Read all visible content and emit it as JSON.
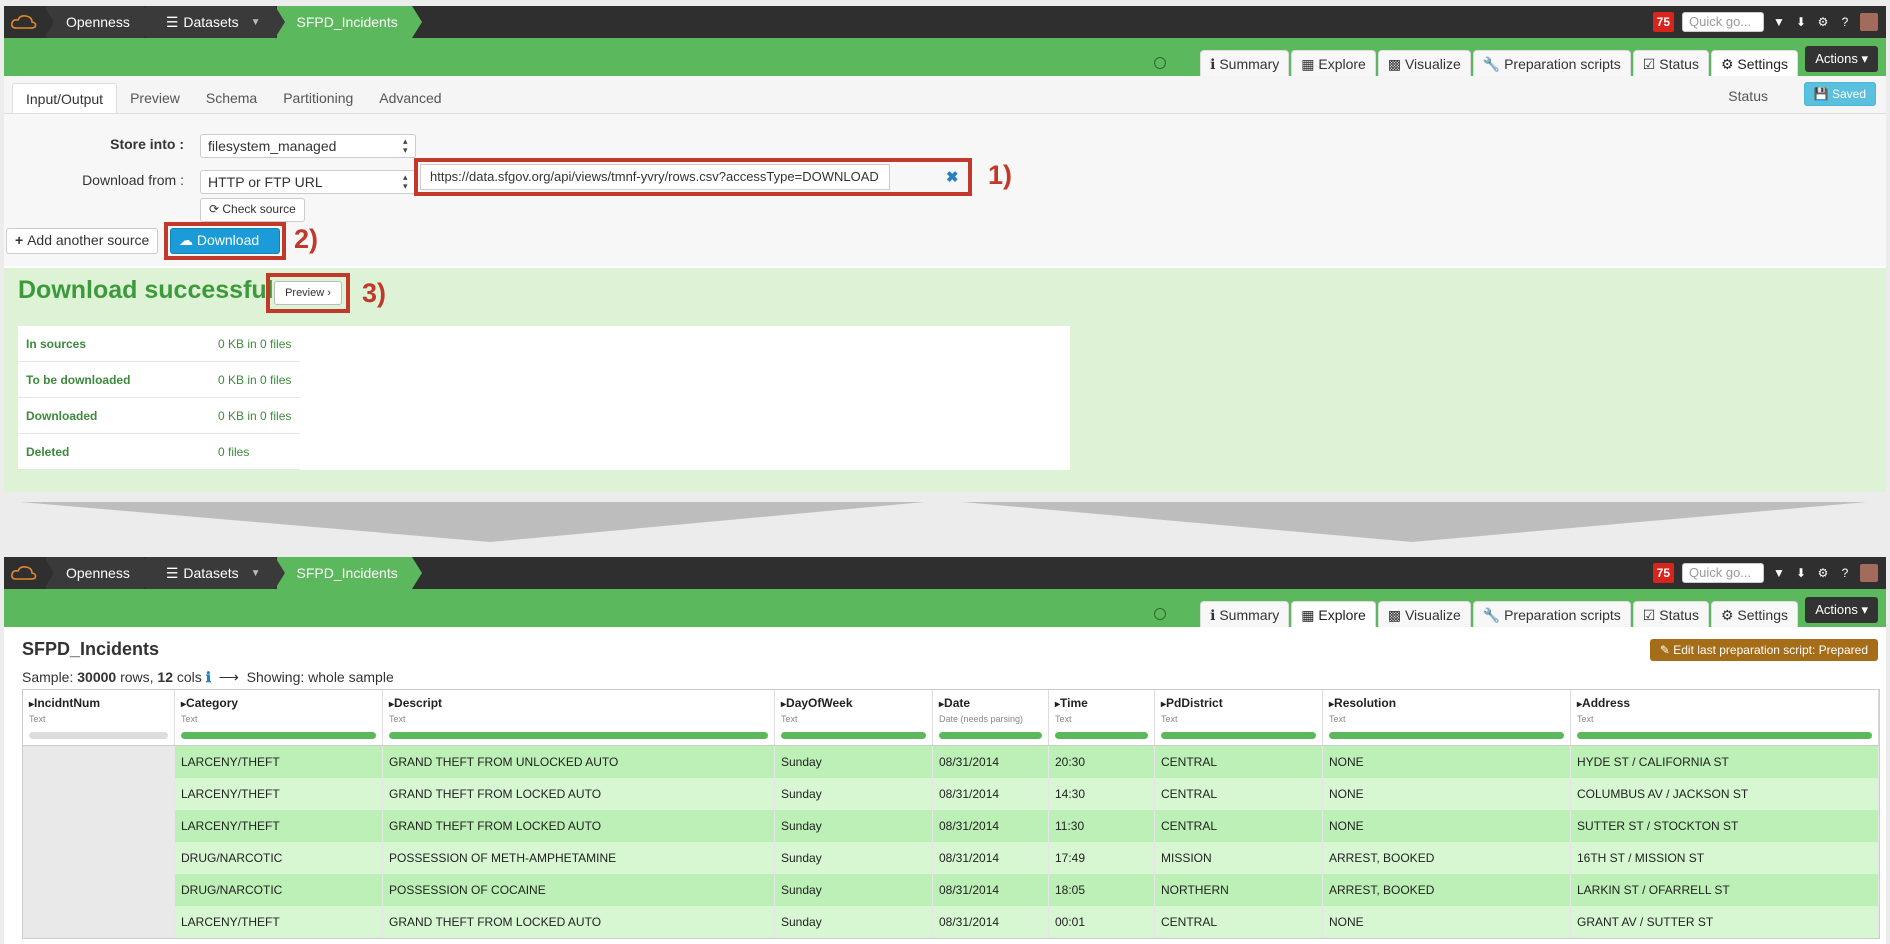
{
  "nav": {
    "crumbs": [
      "Openness",
      "Datasets",
      "SFPD_Incidents"
    ],
    "badge": "75",
    "quick_placeholder": "Quick go...",
    "tabs": [
      "Summary",
      "Explore",
      "Visualize",
      "Preparation scripts",
      "Status",
      "Settings"
    ],
    "actions": "Actions"
  },
  "settings": {
    "subtabs": [
      "Input/Output",
      "Preview",
      "Schema",
      "Partitioning",
      "Advanced"
    ],
    "status_label": "Status",
    "saved_label": "Saved",
    "store_label": "Store into :",
    "store_value": "filesystem_managed",
    "download_from_label": "Download from :",
    "download_from_value": "HTTP or FTP URL",
    "url": "https://data.sfgov.org/api/views/tmnf-yvry/rows.csv?accessType=DOWNLOAD",
    "check_source": "Check source",
    "add_source": "Add another source",
    "download": "Download",
    "annotations": [
      "1)",
      "2)",
      "3)"
    ],
    "success_title": "Download successful",
    "preview_btn": "Preview",
    "stats": [
      {
        "k": "In sources",
        "v": "0 KB in 0 files"
      },
      {
        "k": "To be downloaded",
        "v": "0 KB in 0 files"
      },
      {
        "k": "Downloaded",
        "v": "0 KB in 0 files"
      },
      {
        "k": "Deleted",
        "v": "0 files"
      }
    ]
  },
  "explore": {
    "title": "SFPD_Incidents",
    "edit_btn": "Edit last preparation script: Prepared",
    "sample_prefix": "Sample:",
    "sample_rows": "30000",
    "sample_rows_label": "rows,",
    "sample_cols": "12",
    "sample_cols_label": "cols",
    "showing": "Showing: whole sample",
    "columns": [
      {
        "name": "IncidntNum",
        "type": "Text",
        "empty": true
      },
      {
        "name": "Category",
        "type": "Text"
      },
      {
        "name": "Descript",
        "type": "Text"
      },
      {
        "name": "DayOfWeek",
        "type": "Text"
      },
      {
        "name": "Date",
        "type": "Date (needs parsing)"
      },
      {
        "name": "Time",
        "type": "Text"
      },
      {
        "name": "PdDistrict",
        "type": "Text"
      },
      {
        "name": "Resolution",
        "type": "Text"
      },
      {
        "name": "Address",
        "type": "Text"
      }
    ],
    "rows": [
      [
        "",
        "LARCENY/THEFT",
        "GRAND THEFT FROM UNLOCKED AUTO",
        "Sunday",
        "08/31/2014",
        "20:30",
        "CENTRAL",
        "NONE",
        "HYDE ST / CALIFORNIA ST"
      ],
      [
        "",
        "LARCENY/THEFT",
        "GRAND THEFT FROM LOCKED AUTO",
        "Sunday",
        "08/31/2014",
        "14:30",
        "CENTRAL",
        "NONE",
        "COLUMBUS AV / JACKSON ST"
      ],
      [
        "",
        "LARCENY/THEFT",
        "GRAND THEFT FROM LOCKED AUTO",
        "Sunday",
        "08/31/2014",
        "11:30",
        "CENTRAL",
        "NONE",
        "SUTTER ST / STOCKTON ST"
      ],
      [
        "",
        "DRUG/NARCOTIC",
        "POSSESSION OF METH-AMPHETAMINE",
        "Sunday",
        "08/31/2014",
        "17:49",
        "MISSION",
        "ARREST, BOOKED",
        "16TH ST / MISSION ST"
      ],
      [
        "",
        "DRUG/NARCOTIC",
        "POSSESSION OF COCAINE",
        "Sunday",
        "08/31/2014",
        "18:05",
        "NORTHERN",
        "ARREST, BOOKED",
        "LARKIN ST / OFARRELL ST"
      ],
      [
        "",
        "LARCENY/THEFT",
        "GRAND THEFT FROM LOCKED AUTO",
        "Sunday",
        "08/31/2014",
        "00:01",
        "CENTRAL",
        "NONE",
        "GRANT AV / SUTTER ST"
      ]
    ]
  }
}
